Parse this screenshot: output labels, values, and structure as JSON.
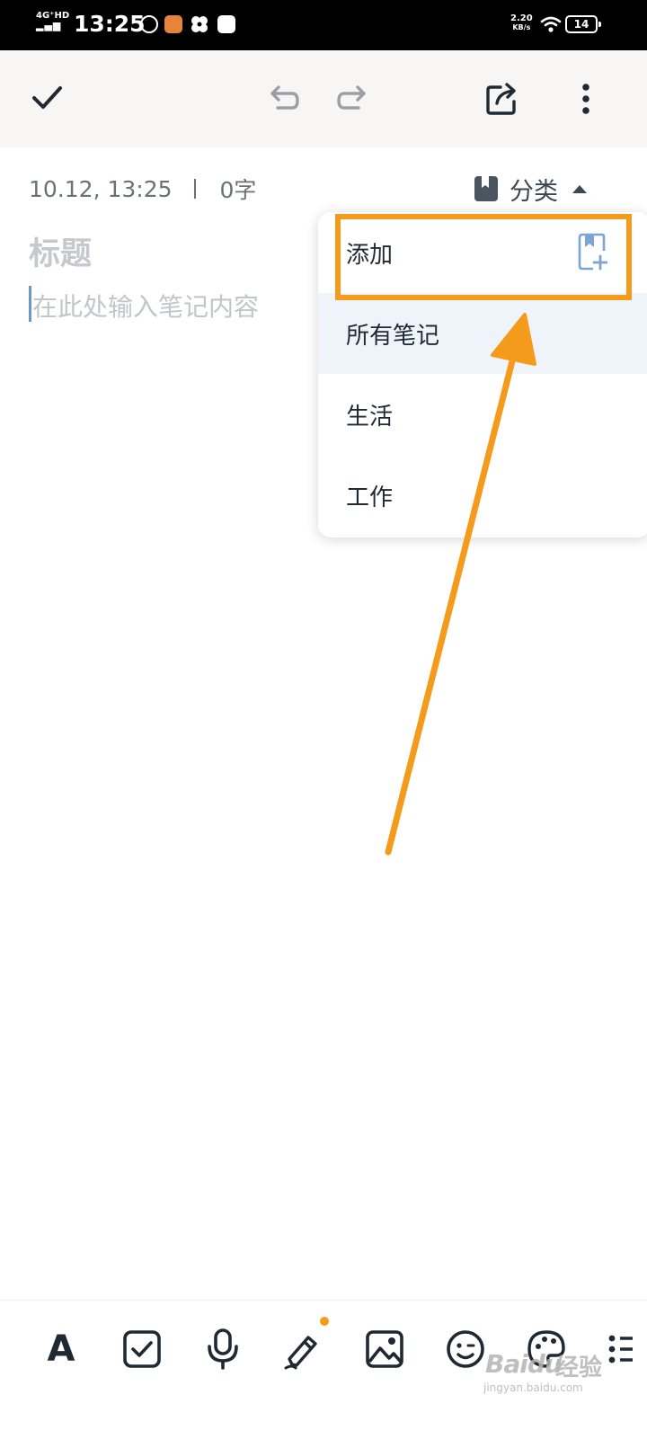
{
  "status_bar": {
    "network": "4G⁺HD",
    "time": "13:25",
    "speed_value": "2.20",
    "speed_unit": "KB/s",
    "battery": "14"
  },
  "toolbar": {
    "icons": [
      "check-icon",
      "undo-icon",
      "redo-icon",
      "share-icon",
      "more-vertical-icon"
    ]
  },
  "note": {
    "timestamp": "10.12, 13:25",
    "word_count": "0字",
    "category_label": "分类",
    "title_placeholder": "标题",
    "body_placeholder": "在此处输入笔记内容"
  },
  "category_menu": {
    "items": [
      {
        "label": "添加",
        "icon": "add-bookmark-icon"
      },
      {
        "label": "所有笔记",
        "selected": true
      },
      {
        "label": "生活"
      },
      {
        "label": "工作"
      }
    ]
  },
  "bottom_toolbar": {
    "text_style_label": "A",
    "icons": [
      "text-style-icon",
      "checklist-icon",
      "microphone-icon",
      "pen-icon",
      "image-icon",
      "emoji-icon",
      "palette-icon",
      "list-icon"
    ]
  },
  "watermark": {
    "logo": "Baidu",
    "brand": "经验",
    "url": "jingyan.baidu.com"
  },
  "colors": {
    "accent_orange": "#f49b1b",
    "selected_row": "#eff4fa",
    "toolbar_bg": "#f7f6f4"
  }
}
